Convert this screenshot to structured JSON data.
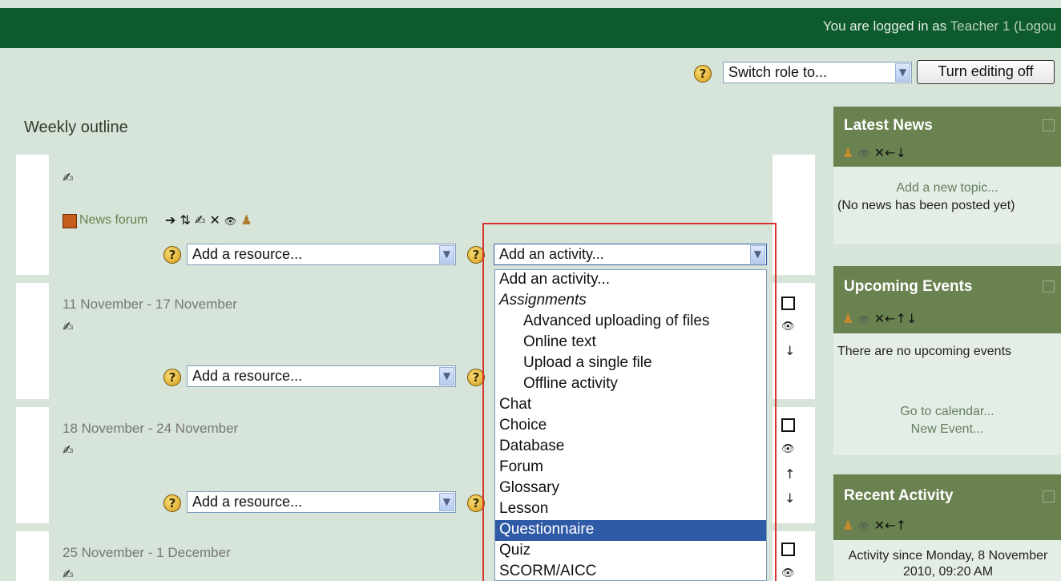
{
  "header": {
    "logged_in_text": "You are logged in as ",
    "user_name": "Teacher 1",
    "logout_text": "(Logou"
  },
  "toolbar": {
    "switch_role_value": "Switch role to...",
    "editing_button": "Turn editing off"
  },
  "page_title": "Weekly outline",
  "topic0": {
    "news_forum": "News forum",
    "resource_select": "Add a resource...",
    "activity_select": "Add an activity..."
  },
  "weeks": [
    {
      "title": "11 November - 17 November",
      "resource_select": "Add a resource..."
    },
    {
      "title": "18 November - 24 November",
      "resource_select": "Add a resource..."
    },
    {
      "title": "25 November - 1 December"
    }
  ],
  "activity_dropdown": {
    "selected_option": "Questionnaire",
    "options": [
      "Add an activity...",
      "Assignments",
      "Advanced uploading of files",
      "Online text",
      "Upload a single file",
      "Offline activity",
      "Chat",
      "Choice",
      "Database",
      "Forum",
      "Glossary",
      "Lesson",
      "Questionnaire",
      "Quiz",
      "SCORM/AICC"
    ]
  },
  "blocks": {
    "latest_news": {
      "title": "Latest News",
      "add_topic": "Add a new topic...",
      "no_news": "(No news has been posted yet)"
    },
    "upcoming_events": {
      "title": "Upcoming Events",
      "no_events": "There are no upcoming events",
      "go_to_calendar": "Go to calendar...",
      "new_event": "New Event..."
    },
    "recent_activity": {
      "title": "Recent Activity",
      "since": "Activity since Monday, 8 November 2010, 09:20 AM"
    }
  },
  "icons": {
    "help": "help-icon",
    "edit": "edit-icon",
    "move": "move-icon",
    "delete": "delete-icon",
    "hide": "eye-icon",
    "roles": "roles-icon",
    "forum": "forum-icon"
  },
  "colors": {
    "header_bg": "#0d5a2c",
    "page_bg": "#d7e4d9",
    "block_header": "#6a8250",
    "selected_option": "#2f5aa6",
    "highlight_frame": "#d9322e"
  }
}
